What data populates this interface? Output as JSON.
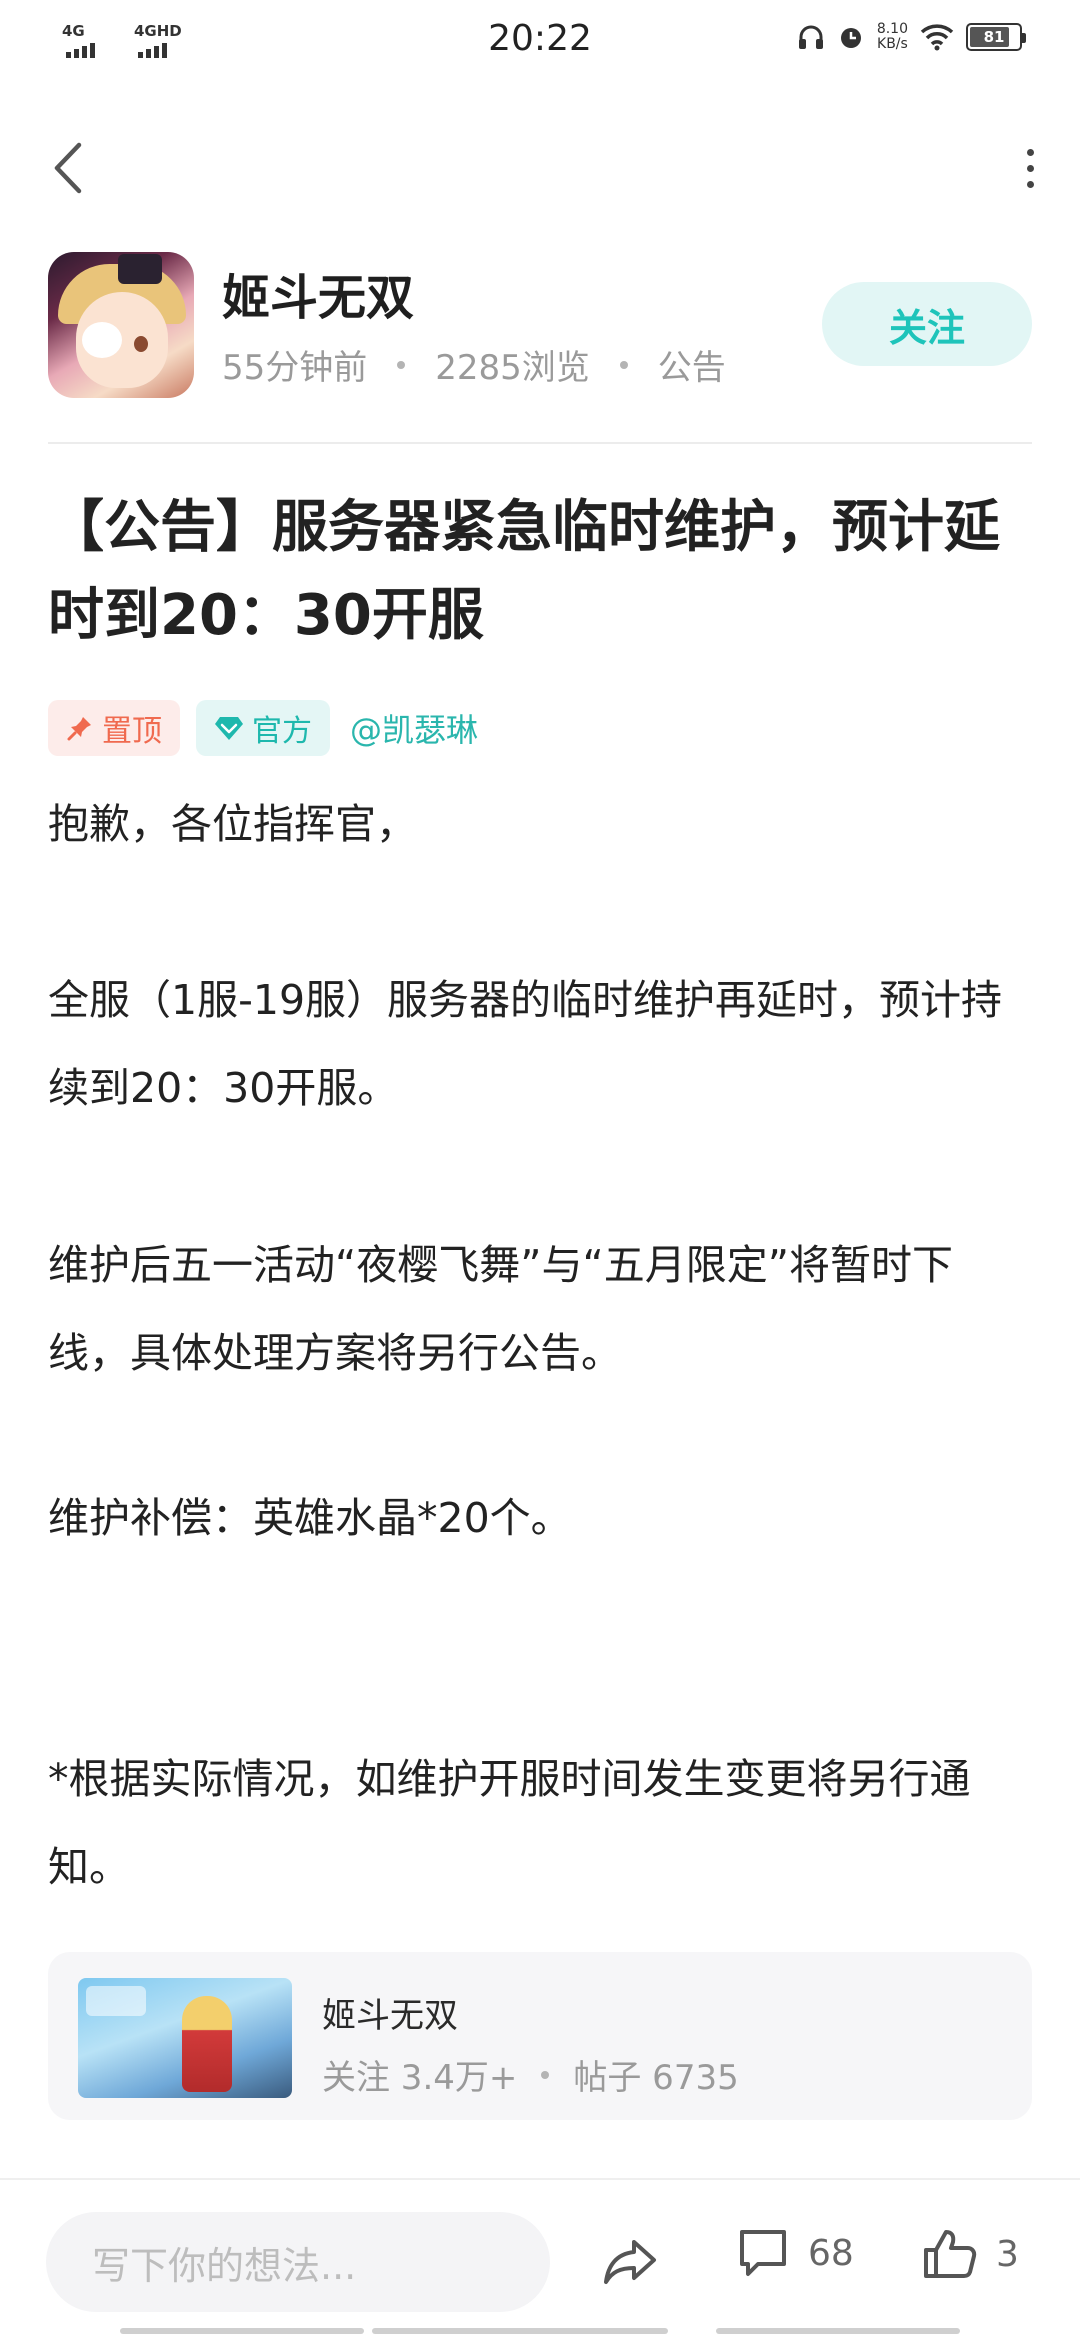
{
  "status_bar": {
    "time": "20:22",
    "network_1": "4G",
    "network_2": "4GHD",
    "speed_value": "8.10",
    "speed_unit": "KB/s",
    "battery": "81",
    "battery_level": 0.81
  },
  "nav": {
    "back_icon": "chevron-left-icon",
    "more_icon": "more-vertical-icon"
  },
  "header": {
    "game_name": "姬斗无双",
    "time_ago": "55分钟前",
    "views": "2285浏览",
    "category": "公告",
    "follow_label": "关注"
  },
  "post": {
    "title": "【公告】服务器紧急临时维护，预计延时到20：30开服",
    "tags": {
      "pinned": "置顶",
      "official": "官方",
      "mention": "@凯瑟琳"
    },
    "paragraphs": {
      "p1": "抱歉，各位指挥官，",
      "p2": "全服（1服-19服）服务器的临时维护再延时，预计持续到20：30开服。",
      "p3": "维护后五一活动“夜樱飞舞”与“五月限定”将暂时下线，具体处理方案将另行公告。",
      "p4": "维护补偿：英雄水晶*20个。",
      "p5": "*根据实际情况，如维护开服时间发生变更将另行通知。"
    }
  },
  "game_card": {
    "name": "姬斗无双",
    "followers": "关注 3.4万+",
    "posts": "帖子 6735"
  },
  "bottom_bar": {
    "comment_placeholder": "写下你的想法...",
    "comment_count": "68",
    "like_count": "3"
  },
  "colors": {
    "accent": "#1ec4ba",
    "pinned": "#f06a4f",
    "follow_bg": "#e2f6f5"
  }
}
